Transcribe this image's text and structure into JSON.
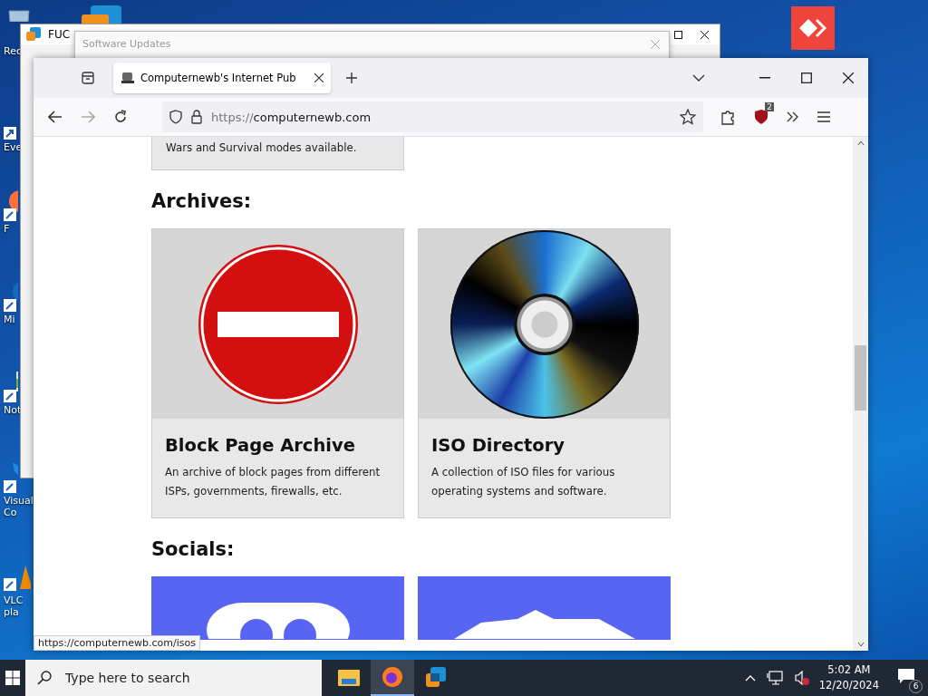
{
  "desktop": {
    "icons": [
      {
        "kind": "bin",
        "label": "Rec"
      },
      {
        "kind": "search",
        "label": "Eve"
      },
      {
        "kind": "fox",
        "label": "F"
      },
      {
        "kind": "wave",
        "label": "Mi"
      },
      {
        "kind": "note",
        "label": "Not"
      },
      {
        "kind": "code",
        "label": "Visual\nCo"
      },
      {
        "kind": "cone",
        "label": "VLC\npla"
      }
    ]
  },
  "background_windows": [
    {
      "kind": "main",
      "title": "FUC"
    },
    {
      "kind": "dialog",
      "title": "Software Updates"
    }
  ],
  "browser": {
    "tabs": [
      {
        "title": "Computernewb's Internet Pub",
        "selected": true
      }
    ],
    "url_scheme": "https://",
    "url_host": "computernewb.com",
    "extension_badge": "2",
    "sections": [
      {
        "kind": "tail",
        "text": "Wars and Survival modes available."
      },
      {
        "kind": "cards",
        "heading": "Archives:",
        "cards": [
          {
            "kind": "block",
            "title": "Block Page Archive",
            "text": "An archive of block pages from different ISPs, governments, firewalls, etc."
          },
          {
            "kind": "disc",
            "title": "ISO Directory",
            "text": "A collection of ISO files for various operating systems and software."
          }
        ]
      },
      {
        "kind": "cards",
        "heading": "Socials:",
        "cards": [
          {
            "kind": "pad"
          },
          {
            "kind": "blob"
          }
        ]
      }
    ],
    "status_link": "https://computernewb.com/isos"
  },
  "taskbar": {
    "search_placeholder": "Type here to search",
    "apps": [
      {
        "kind": "folder",
        "selected": false
      },
      {
        "kind": "fox",
        "selected": true
      },
      {
        "kind": "vm",
        "selected": false
      }
    ],
    "time": "5:02 AM",
    "date": "12/20/2024",
    "notification_count": "6"
  }
}
